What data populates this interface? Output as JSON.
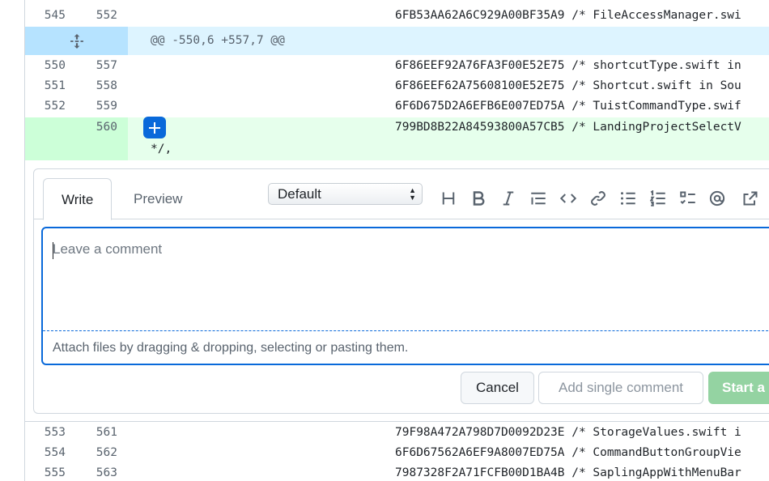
{
  "diff": {
    "rows_top": [
      {
        "old": "545",
        "new": "552",
        "code": "6FB53AA62A6C929A00BF35A9 /* FileAccessManager.swi"
      }
    ],
    "hunk": "@@ -550,6 +557,7 @@",
    "rows_mid": [
      {
        "old": "550",
        "new": "557",
        "code": "6F86EEF92A76FA3F00E52E75 /* shortcutType.swift in"
      },
      {
        "old": "551",
        "new": "558",
        "code": "6F86EEF62A75608100E52E75 /* Shortcut.swift in Sou"
      },
      {
        "old": "552",
        "new": "559",
        "code": "6F6D675D2A6EFB6E007ED75A /* TuistCommandType.swif"
      }
    ],
    "added": {
      "new": "560",
      "code": "799BD8B22A84593800A57CB5 /* LandingProjectSelectV",
      "continuation": "*/,"
    },
    "rows_bottom": [
      {
        "old": "553",
        "new": "561",
        "code": "79F98A472A798D7D0092D23E /* StorageValues.swift i"
      },
      {
        "old": "554",
        "new": "562",
        "code": "6F6D67562A6EF9A8007ED75A /* CommandButtonGroupVie"
      },
      {
        "old": "555",
        "new": "563",
        "code": "7987328F2A71FCFB00D1BA4B /* SaplingAppWithMenuBar"
      }
    ]
  },
  "comment": {
    "tabs": {
      "write": "Write",
      "preview": "Preview"
    },
    "select_value": "Default",
    "placeholder": "Leave a comment",
    "attach_hint": "Attach files by dragging & dropping, selecting or pasting them.",
    "buttons": {
      "cancel": "Cancel",
      "single": "Add single comment",
      "start": "Start a"
    },
    "toolbar_icons": [
      "heading-icon",
      "bold-icon",
      "italic-icon",
      "quote-icon",
      "code-icon",
      "link-icon",
      "unordered-list-icon",
      "ordered-list-icon",
      "task-list-icon",
      "mention-icon",
      "reference-icon"
    ]
  },
  "colors": {
    "accent": "#0969da",
    "added_bg": "#e6ffec",
    "hunk_bg": "#ddf4ff",
    "start_btn": "#94d3a2"
  }
}
